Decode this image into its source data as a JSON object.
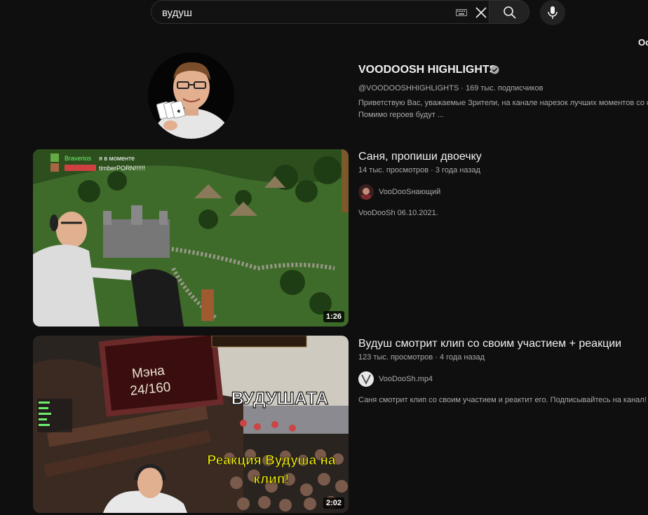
{
  "search": {
    "query": "вудуш"
  },
  "corner_label": "Ос",
  "channel": {
    "name": "VOODOOSH HIGHLIGHTS",
    "meta": "@VOODOOSHHIGHLIGHTS · 169 тыс. подписчиков",
    "desc_line1": "Приветствую Вас, уважаемые Зрители, на канале нарезок лучших моментов со с",
    "desc_line2": "Помимо героев будут ..."
  },
  "videos": [
    {
      "title": "Саня, пропиши двоечку",
      "meta": "14 тыс. просмотров · 3 года назад",
      "channel": "VooDooSнающий",
      "desc": "VooDooSh 06.10.2021.",
      "duration": "1:26",
      "overlay_chat1_name": "Braverios",
      "overlay_chat1_text": "я в моменте",
      "overlay_chat2_text": "timberPORN!!!!!!"
    },
    {
      "title": "Вудуш смотрит клип со своим участием + реакции",
      "meta": "123 тыс. просмотров · 4 года назад",
      "channel": "VooDooSh.mp4",
      "desc": "Саня смотрит клип со своим участием и реактит его. Подписывайтесь на канал!",
      "duration": "2:02",
      "overlay_mana_label": "Мэна",
      "overlay_mana_value": "24/160",
      "overlay_banner": "ВУДУШАТА",
      "overlay_caption1": "Реакция Вудуша на",
      "overlay_caption2": "клип!"
    }
  ],
  "colors": {
    "background": "#0f0f0f",
    "text": "#f1f1f1",
    "secondary": "#aaaaaa",
    "caption": "#f4f000"
  }
}
